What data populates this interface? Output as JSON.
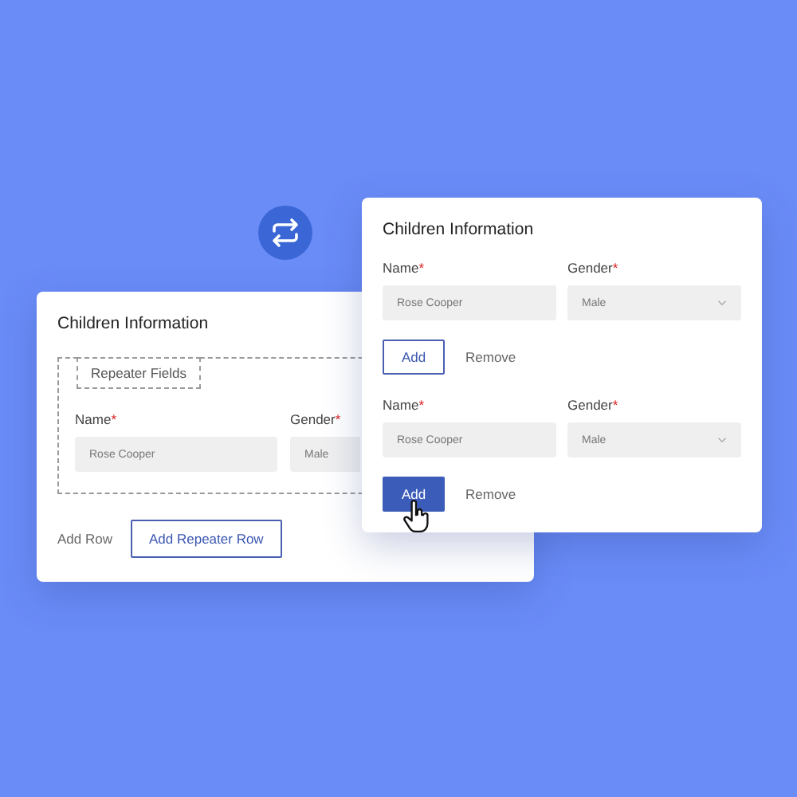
{
  "back_card": {
    "title": "Children Information",
    "repeater_legend": "Repeater Fields",
    "fields": [
      {
        "label": "Name",
        "required_mark": "*",
        "value": "Rose Cooper",
        "kind": "text"
      },
      {
        "label": "Gender",
        "required_mark": "*",
        "value": "Male",
        "kind": "select"
      }
    ],
    "add_row_label": "Add Row",
    "add_row_button": "Add Repeater Row"
  },
  "front_card": {
    "title": "Children Information",
    "rows": [
      {
        "fields": [
          {
            "label": "Name",
            "required_mark": "*",
            "value": "Rose Cooper",
            "kind": "text"
          },
          {
            "label": "Gender",
            "required_mark": "*",
            "value": "Male",
            "kind": "select"
          }
        ],
        "add": "Add",
        "pressed": false,
        "remove": "Remove"
      },
      {
        "fields": [
          {
            "label": "Name",
            "required_mark": "*",
            "value": "Rose Cooper",
            "kind": "text"
          },
          {
            "label": "Gender",
            "required_mark": "*",
            "value": "Male",
            "kind": "select"
          }
        ],
        "add": "Add",
        "pressed": true,
        "remove": "Remove"
      }
    ]
  }
}
